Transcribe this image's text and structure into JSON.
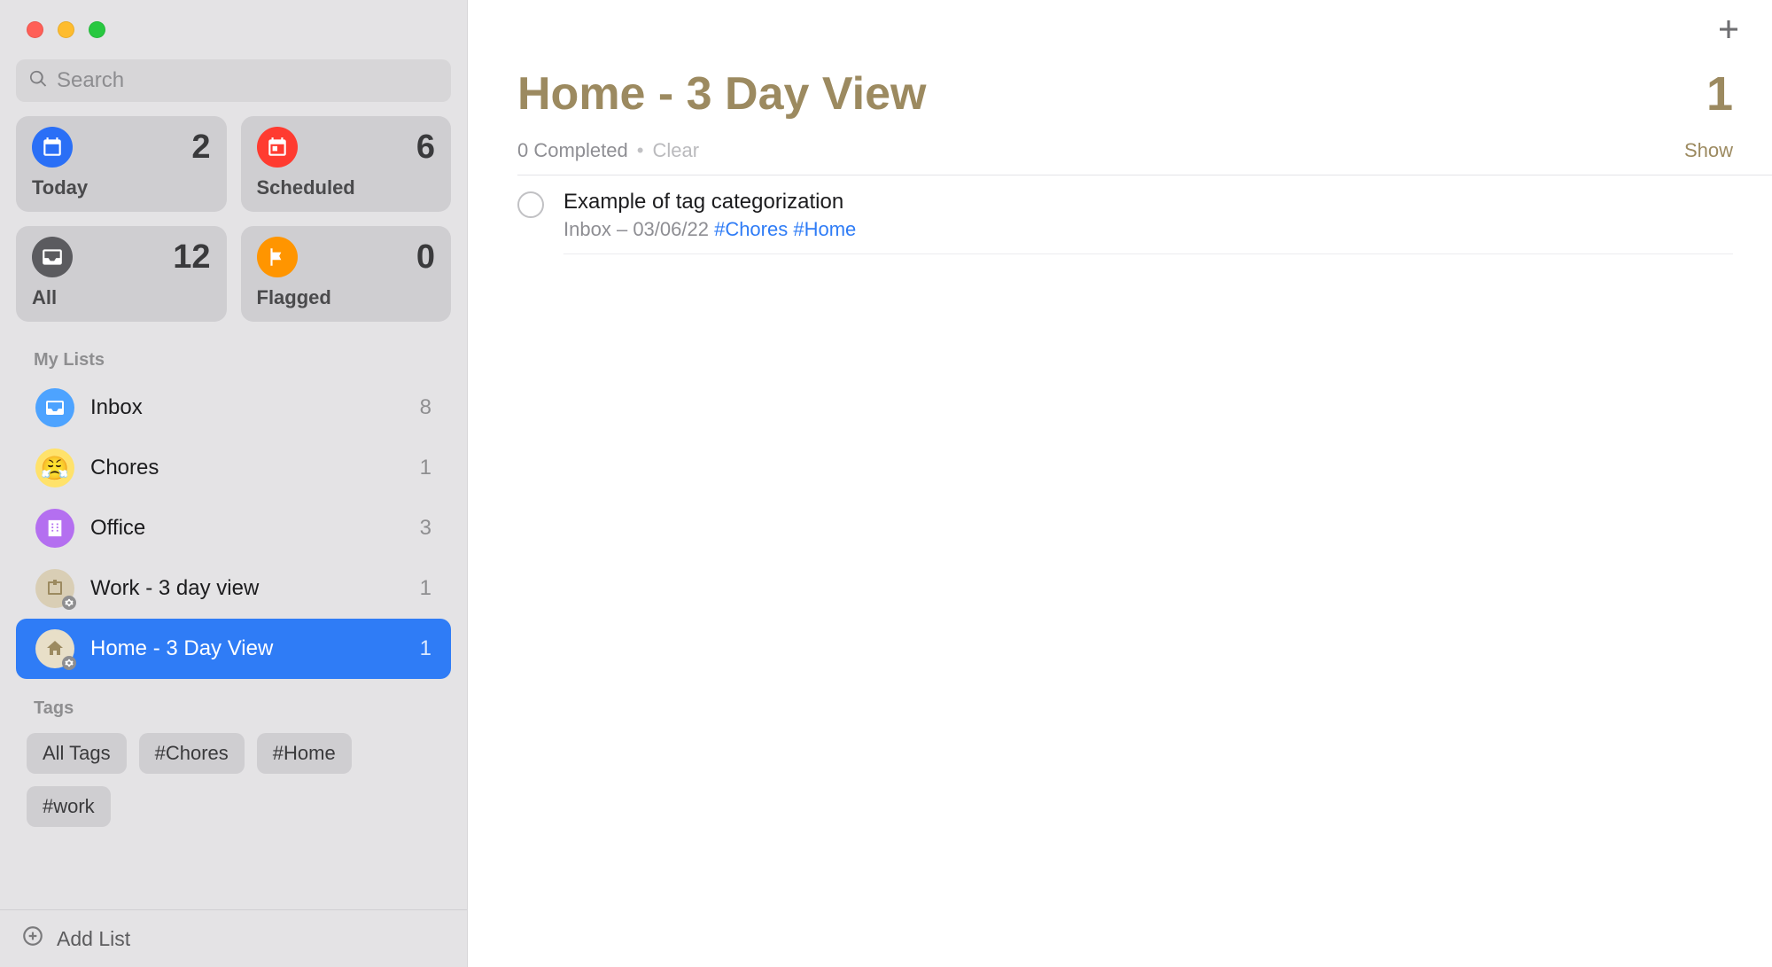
{
  "search": {
    "placeholder": "Search"
  },
  "cards": {
    "today": {
      "label": "Today",
      "count": "2"
    },
    "scheduled": {
      "label": "Scheduled",
      "count": "6"
    },
    "all": {
      "label": "All",
      "count": "12"
    },
    "flagged": {
      "label": "Flagged",
      "count": "0"
    }
  },
  "sections": {
    "lists_title": "My Lists",
    "tags_title": "Tags"
  },
  "lists": [
    {
      "label": "Inbox",
      "count": "8"
    },
    {
      "label": "Chores",
      "count": "1"
    },
    {
      "label": "Office",
      "count": "3"
    },
    {
      "label": "Work - 3 day view",
      "count": "1"
    },
    {
      "label": "Home - 3 Day View",
      "count": "1"
    }
  ],
  "tags": [
    "All Tags",
    "#Chores",
    "#Home",
    "#work"
  ],
  "footer": {
    "add_list": "Add List"
  },
  "main": {
    "title": "Home - 3 Day View",
    "count": "1",
    "completed_text": "0 Completed",
    "clear": "Clear",
    "show": "Show"
  },
  "reminders": [
    {
      "title": "Example of tag categorization",
      "list": "Inbox",
      "date": "03/06/22",
      "tags": [
        "#Chores",
        "#Home"
      ]
    }
  ]
}
